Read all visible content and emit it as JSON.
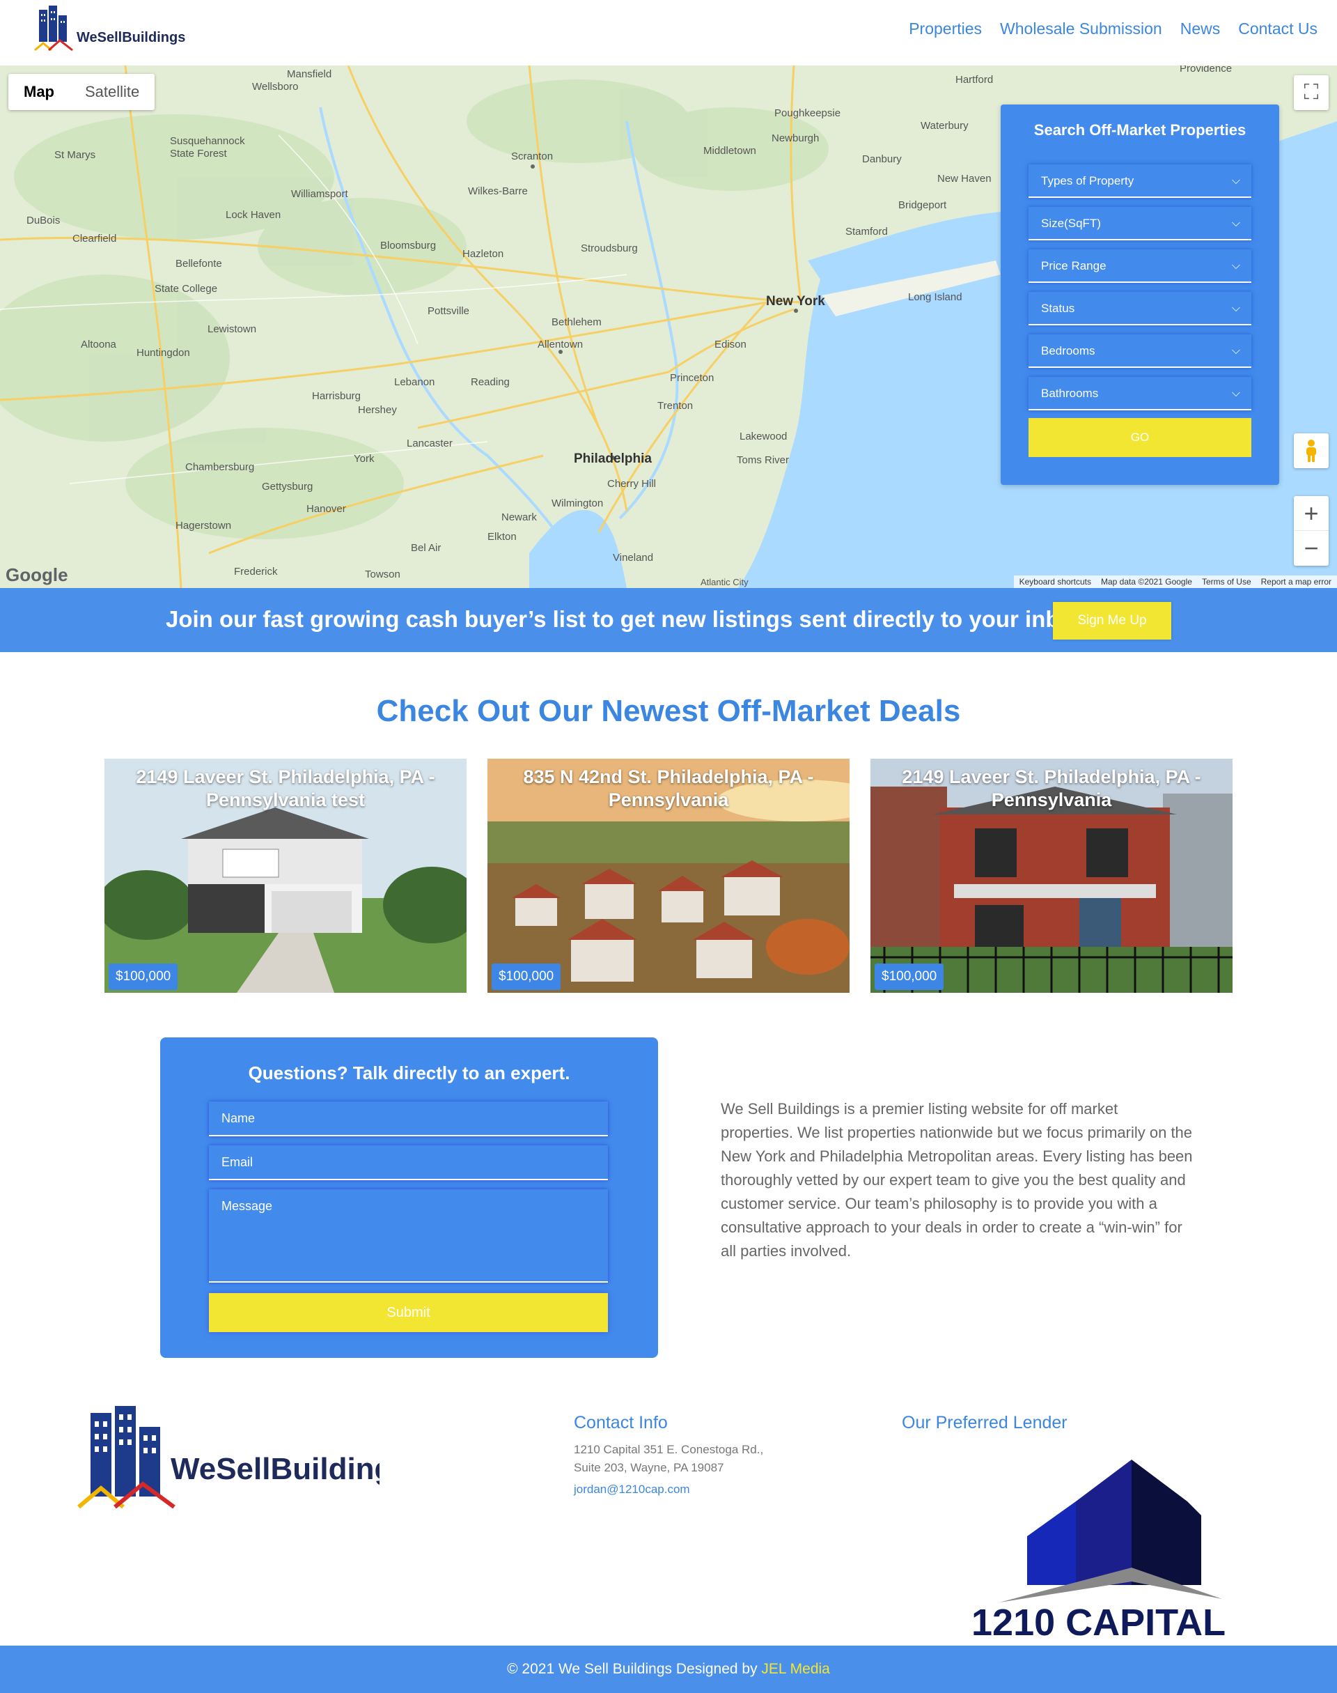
{
  "header": {
    "logo_text": "WeSellBuildings",
    "nav": [
      "Properties",
      "Wholesale Submission",
      "News",
      "Contact Us"
    ]
  },
  "map": {
    "type_buttons": [
      "Map",
      "Satellite"
    ],
    "google": "Google",
    "footer_links": [
      "Keyboard shortcuts",
      "Map data ©2021 Google",
      "Terms of Use",
      "Report a map error"
    ],
    "labels": [
      "New York",
      "Philadelphia",
      "Allentown",
      "Bethlehem",
      "Scranton",
      "Wilkes-Barre",
      "Harrisburg",
      "Reading",
      "Lancaster",
      "Trenton",
      "Edison",
      "Princeton",
      "Stamford",
      "Danbury",
      "Bridgeport",
      "New Haven",
      "Hartford",
      "Poughkeepsie",
      "Newburgh",
      "Middletown",
      "Williamsport",
      "State College",
      "Altoona",
      "York",
      "Hagerstown",
      "Frederick",
      "Wilmington",
      "Newark",
      "Vineland",
      "Toms River",
      "Lakewood",
      "Cherry Hill",
      "Long Island",
      "Providence",
      "Waterbury",
      "Stroudsburg",
      "Hazleton",
      "Bloomsburg",
      "Pottsville",
      "Lebanon",
      "Hershey",
      "Gettysburg",
      "Chambersburg",
      "Huntingdon",
      "Lewistown",
      "Bellefonte",
      "Clearfield",
      "DuBois",
      "St Marys",
      "Mansfield",
      "Wellsboro",
      "Lock Haven",
      "Hanover",
      "Towson",
      "Bel Air",
      "Elkton",
      "Susquehannock State Forest",
      "Atlantic City"
    ],
    "zoom_in": "+",
    "zoom_out": "−"
  },
  "search": {
    "title": "Search Off-Market Properties",
    "filters": [
      "Types of Property",
      "Size(SqFT)",
      "Price Range",
      "Status",
      "Bedrooms",
      "Bathrooms"
    ],
    "go_label": "GO"
  },
  "banner": {
    "text": "Join our fast growing cash buyer’s list to get new listings sent directly to your inbox",
    "button": "Sign Me Up"
  },
  "deals": {
    "heading": "Check Out Our Newest Off-Market Deals",
    "cards": [
      {
        "title": "2149 Laveer St. Philadelphia, PA - Pennsylvania test",
        "price": "$100,000"
      },
      {
        "title": "835 N 42nd St. Philadelphia, PA - Pennsylvania",
        "price": "$100,000"
      },
      {
        "title": "2149 Laveer St. Philadelphia, PA - Pennsylvania",
        "price": "$100,000"
      }
    ]
  },
  "contact_form": {
    "title": "Questions? Talk directly to an expert.",
    "name_placeholder": "Name",
    "email_placeholder": "Email",
    "message_placeholder": "Message",
    "submit": "Submit"
  },
  "about": {
    "text": "We Sell Buildings is a premier listing website for off market properties. We list properties nationwide but we focus primarily on the New York and Philadelphia Metropolitan areas. Every listing has been thoroughly vetted by our expert team to give you the best quality and customer service. Our team’s philosophy is to provide you with a consultative approach to your deals in order to create a “win-win” for all parties involved."
  },
  "footer": {
    "logo_text": "WeSellBuildings",
    "contact_heading": "Contact Info",
    "address_line1": "1210 Capital 351 E. Conestoga Rd.,",
    "address_line2": "Suite 203, Wayne, PA 19087",
    "email": "jordan@1210cap.com",
    "lender_heading": "Our Preferred Lender",
    "lender_name": "1210 CAPITAL",
    "copyright": "© 2021 We Sell Buildings Designed by ",
    "designer": "JEL Media"
  },
  "colors": {
    "brand_blue": "#4a90ea",
    "accent_yellow": "#f3e633",
    "link_blue": "#3b86e0"
  }
}
